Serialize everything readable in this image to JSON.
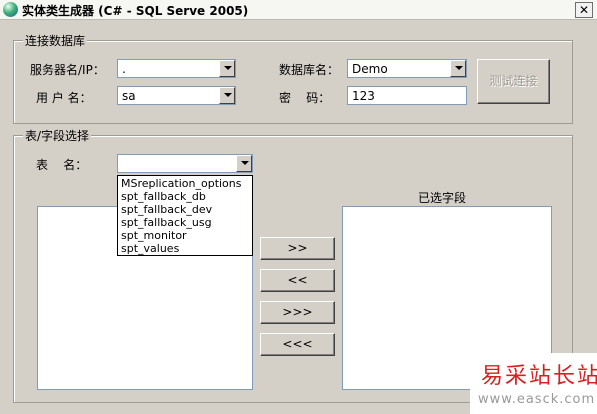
{
  "window": {
    "title": "实体类生成器 (C# - SQL Serve 2005)",
    "close_glyph": "✕"
  },
  "connection": {
    "legend": "连接数据库",
    "server_label": "服务器名/IP：",
    "server_value": ".",
    "user_label": "用 户 名：",
    "user_value": "sa",
    "database_label": "数据库名：",
    "database_value": "Demo",
    "password_label": "密    码：",
    "password_value": "123",
    "test_button": "测试连接"
  },
  "fields": {
    "legend": "表/字段选择",
    "table_label": "表    名：",
    "table_value": "",
    "table_options": [
      "MSreplication_options",
      "spt_fallback_db",
      "spt_fallback_dev",
      "spt_fallback_usg",
      "spt_monitor",
      "spt_values"
    ],
    "selected_label": "已选字段",
    "buttons": {
      "add": ">>",
      "remove": "<<",
      "add_all": ">>>",
      "remove_all": "<<<"
    }
  },
  "watermark": {
    "text": "易采站长站",
    "url": "www.easck.com"
  },
  "colors": {
    "watermark_red": "#d82020",
    "window_bg": "#d4d0c8",
    "input_border": "#7f9db9"
  }
}
